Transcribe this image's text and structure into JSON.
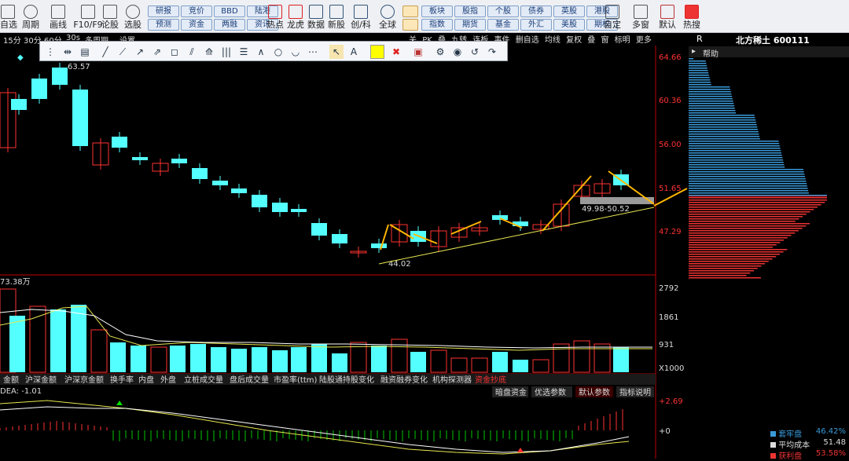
{
  "toolbar": {
    "items": [
      "自选",
      "周期",
      "画线",
      "F10/F9",
      "论股",
      "选股"
    ],
    "buttons": [
      "研报",
      "竞价",
      "BBD",
      "陆港",
      "预测",
      "资金",
      "两融",
      "资讯"
    ],
    "mid_items": [
      "热点",
      "龙虎",
      "数据",
      "新股",
      "创/科",
      "全球"
    ],
    "buttons2": [
      "板块",
      "股指",
      "个股",
      "债券",
      "英股",
      "港股",
      "指数",
      "期货",
      "基金",
      "外汇",
      "美股",
      "期权"
    ],
    "right_items": [
      "自定",
      "多窗",
      "默认",
      "热搜"
    ]
  },
  "periods": [
    "15分",
    "30分",
    "60分",
    "30s",
    "多周期",
    "设置"
  ],
  "right_tabs": [
    "关",
    "PK",
    "叠",
    "九转",
    "连板",
    "事件",
    "删自选",
    "均线",
    "复权",
    "叠",
    "窗",
    "标明",
    "更多"
  ],
  "price_axis": [
    "64.66",
    "60.36",
    "56.00",
    "51.65",
    "47.29"
  ],
  "vol_axis": [
    "2792",
    "1861",
    "931",
    "X1000"
  ],
  "macd_axis": [
    "+2.69",
    "+0"
  ],
  "chart_labels": {
    "high": "63.57",
    "low": "44.02",
    "zone": "49.98-50.52",
    "vol_title": "73.38万",
    "macd_title": "DEA: -1.01"
  },
  "indicator_tabs": [
    "金额",
    "沪深金额",
    "沪深京金额",
    "换手率",
    "内盘",
    "外盘",
    "立桩成交量",
    "盘后成交量",
    "市盈率(ttm)",
    "陆股通持股变化",
    "融资融券变化",
    "机构探测器",
    "资金抄底"
  ],
  "param_buttons": [
    "暗盘资金",
    "优选参数",
    "默认参数",
    "指标说明"
  ],
  "side": {
    "code": "R",
    "stock": "北方稀土 600111",
    "help": "帮助",
    "legend": [
      {
        "label": "套牢盘",
        "value": "46.42%"
      },
      {
        "label": "平均成本",
        "value": "51.48"
      },
      {
        "label": "获利盘",
        "value": "53.58%"
      }
    ]
  },
  "colors": {
    "up": "#ff3232",
    "down": "#54ffff",
    "arrow": "#ffb600",
    "axis": "#c00000"
  }
}
